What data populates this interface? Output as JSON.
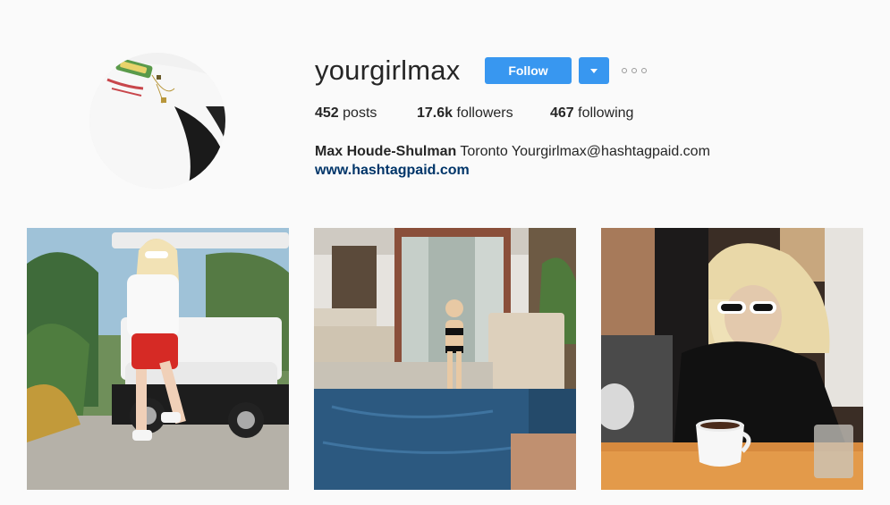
{
  "profile": {
    "username": "yourgirlmax",
    "follow_label": "Follow",
    "posts_count": "452",
    "posts_label": "posts",
    "followers_count": "17.6k",
    "followers_label": "followers",
    "following_count": "467",
    "following_label": "following",
    "full_name": "Max Houde-Shulman",
    "bio_text": "Toronto Yourgirlmax@hashtagpaid.com",
    "website": "www.hashtagpaid.com"
  },
  "icons": {
    "dropdown": "chevron-down-icon",
    "more": "more-options-icon"
  },
  "colors": {
    "accent": "#3897f0",
    "link": "#003569",
    "background": "#fafafa"
  }
}
